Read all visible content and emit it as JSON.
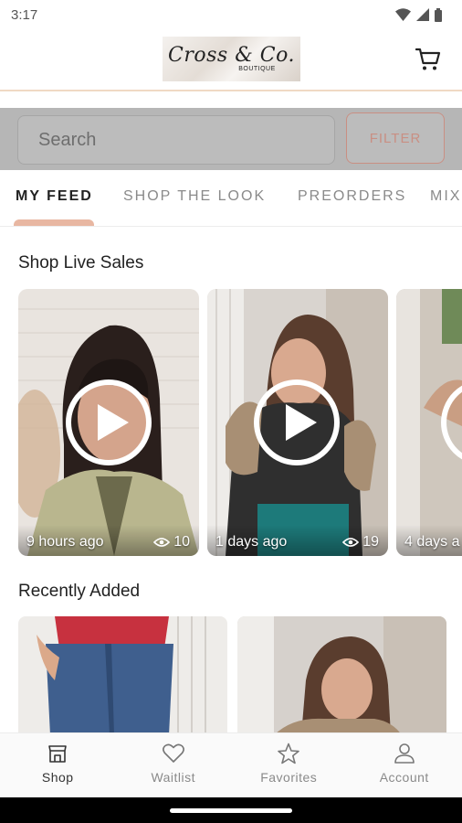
{
  "status_bar": {
    "time": "3:17"
  },
  "header": {
    "logo_main": "Cross & Co.",
    "logo_sub": "BOUTIQUE",
    "cart_icon": "cart-icon"
  },
  "search": {
    "placeholder": "Search",
    "filter_label": "FILTER"
  },
  "tabs": [
    {
      "label": "MY FEED",
      "active": true
    },
    {
      "label": "SHOP THE LOOK"
    },
    {
      "label": "PREORDERS"
    },
    {
      "label": "MIX"
    }
  ],
  "live_sales": {
    "title": "Shop Live Sales",
    "videos": [
      {
        "time": "9 hours ago",
        "views": "10"
      },
      {
        "time": "1 days ago",
        "views": "19"
      },
      {
        "time": "4 days a"
      }
    ]
  },
  "recently_added": {
    "title": "Recently Added"
  },
  "bottom_nav": [
    {
      "label": "Shop",
      "icon": "shop-icon",
      "active": true
    },
    {
      "label": "Waitlist",
      "icon": "heart-icon"
    },
    {
      "label": "Favorites",
      "icon": "star-icon"
    },
    {
      "label": "Account",
      "icon": "person-icon"
    }
  ],
  "colors": {
    "accent": "#c98f83",
    "tab_indicator": "#e8b7a2",
    "header_border": "#f0d9c4"
  }
}
